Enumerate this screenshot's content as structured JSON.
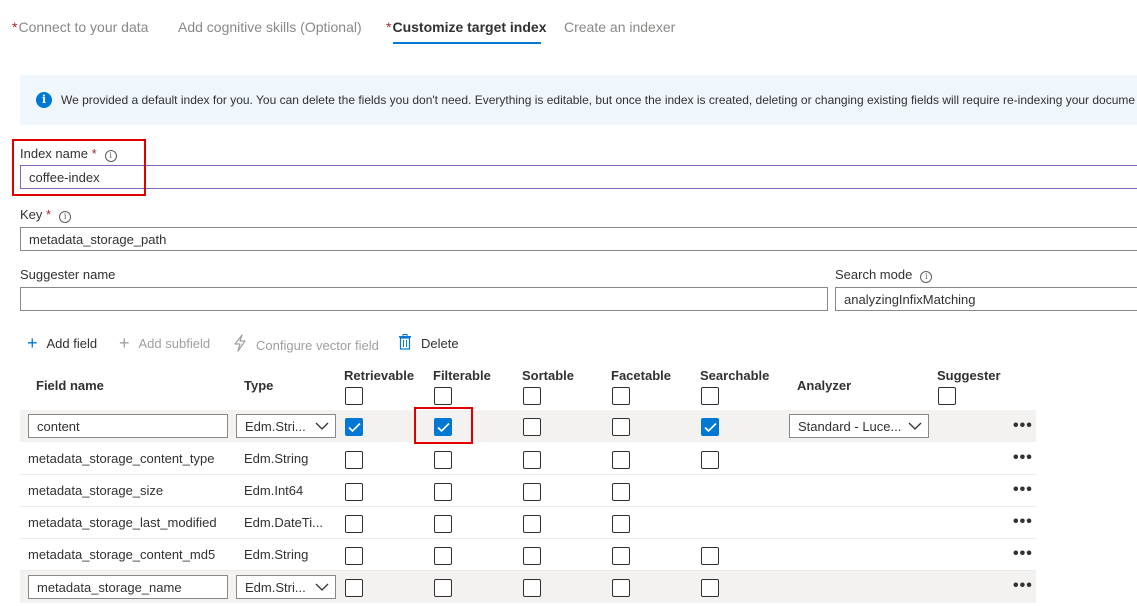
{
  "wizard": {
    "steps": [
      {
        "label": "Connect to your data",
        "required": true,
        "active": false
      },
      {
        "label": "Add cognitive skills (Optional)",
        "required": false,
        "active": false
      },
      {
        "label": "Customize target index",
        "required": true,
        "active": true
      },
      {
        "label": "Create an indexer",
        "required": false,
        "active": false
      }
    ],
    "required_marker": "*"
  },
  "banner": {
    "icon": "info-icon",
    "text": "We provided a default index for you. You can delete the fields you don't need. Everything is editable, but once the index is created, deleting or changing existing fields will require re-indexing your docume"
  },
  "form": {
    "index_name": {
      "label": "Index name",
      "required": "*",
      "value": "coffee-index"
    },
    "key": {
      "label": "Key",
      "required": "*",
      "value": "metadata_storage_path"
    },
    "suggester_name": {
      "label": "Suggester name",
      "value": ""
    },
    "search_mode": {
      "label": "Search mode",
      "value": "analyzingInfixMatching"
    }
  },
  "toolbar": {
    "add_field": {
      "label": "Add field",
      "icon": "plus-icon",
      "enabled": true
    },
    "add_subfield": {
      "label": "Add subfield",
      "icon": "plus-icon",
      "enabled": false
    },
    "configure_vector": {
      "label": "Configure vector field",
      "icon": "lightning-icon",
      "enabled": false
    },
    "delete": {
      "label": "Delete",
      "icon": "trash-icon",
      "enabled": true
    }
  },
  "table": {
    "headers": {
      "field_name": "Field name",
      "type": "Type",
      "retrievable": "Retrievable",
      "filterable": "Filterable",
      "sortable": "Sortable",
      "facetable": "Facetable",
      "searchable": "Searchable",
      "analyzer": "Analyzer",
      "suggester": "Suggester"
    },
    "rows": [
      {
        "name": "content",
        "type": "Edm.Stri...",
        "editable": true,
        "retrievable": true,
        "filterable": true,
        "sortable": false,
        "facetable": false,
        "searchable": true,
        "analyzer": "Standard - Luce...",
        "more": "•••"
      },
      {
        "name": "metadata_storage_content_type",
        "type": "Edm.String",
        "editable": false,
        "retrievable": false,
        "filterable": false,
        "sortable": false,
        "facetable": false,
        "searchable": false,
        "analyzer": "",
        "more": "•••"
      },
      {
        "name": "metadata_storage_size",
        "type": "Edm.Int64",
        "editable": false,
        "retrievable": false,
        "filterable": false,
        "sortable": false,
        "facetable": false,
        "searchable": null,
        "analyzer": "",
        "more": "•••"
      },
      {
        "name": "metadata_storage_last_modified",
        "type": "Edm.DateTi...",
        "editable": false,
        "retrievable": false,
        "filterable": false,
        "sortable": false,
        "facetable": false,
        "searchable": null,
        "analyzer": "",
        "more": "•••"
      },
      {
        "name": "metadata_storage_content_md5",
        "type": "Edm.String",
        "editable": false,
        "retrievable": false,
        "filterable": false,
        "sortable": false,
        "facetable": false,
        "searchable": false,
        "analyzer": "",
        "more": "•••"
      },
      {
        "name": "metadata_storage_name",
        "type": "Edm.Stri...",
        "editable": true,
        "retrievable": false,
        "filterable": false,
        "sortable": false,
        "facetable": false,
        "searchable": false,
        "analyzer": "",
        "more": "•••"
      }
    ]
  },
  "colors": {
    "accent": "#0078d4",
    "required": "#a4262c",
    "highlight_box": "#e00000",
    "banner_bg": "#eff6fc"
  }
}
